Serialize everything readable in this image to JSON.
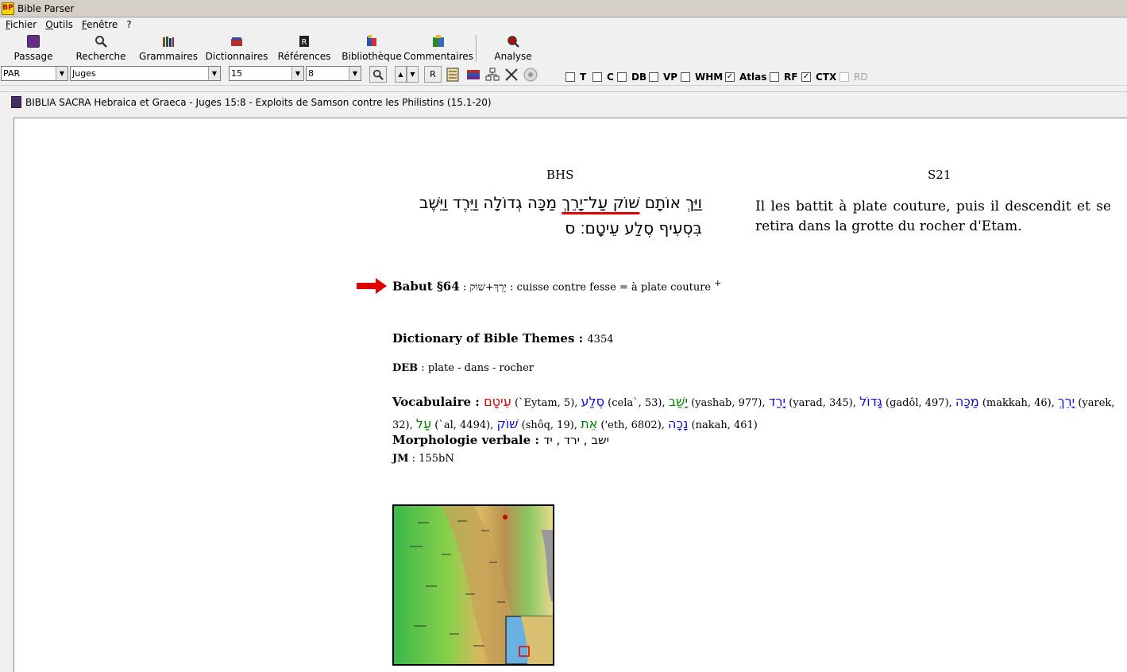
{
  "window": {
    "title": "Bible Parser",
    "app_icon": "BP"
  },
  "menu": [
    "Fichier",
    "Outils",
    "Fenêtre",
    "?"
  ],
  "toolbar": {
    "buttons": [
      {
        "label": "Passage",
        "icon": "passage-icon",
        "color": "#6a2a8a"
      },
      {
        "label": "Recherche",
        "icon": "search-icon",
        "color": "#333333"
      },
      {
        "label": "Grammaires",
        "icon": "books-icon",
        "color": "#7a4a2a"
      },
      {
        "label": "Dictionnaires",
        "icon": "dictionary-icon",
        "color": "#b03030"
      },
      {
        "label": "Références",
        "icon": "references-icon",
        "color": "#222222"
      },
      {
        "label": "Bibliothèque",
        "icon": "library-icon",
        "color": "#3050b0"
      },
      {
        "label": "Commentaires",
        "icon": "comments-icon",
        "color": "#2a8a2a"
      },
      {
        "label": "Analyse",
        "icon": "analyse-icon",
        "color": "#b01010"
      }
    ]
  },
  "controls": {
    "version": "PAR",
    "book": "Juges",
    "chapter": "15",
    "verse": "8",
    "r_button": "R",
    "checkboxes": [
      {
        "label": "T",
        "checked": false,
        "enabled": true
      },
      {
        "label": "C",
        "checked": false,
        "enabled": true
      },
      {
        "label": "DB",
        "checked": false,
        "enabled": true
      },
      {
        "label": "VP",
        "checked": false,
        "enabled": true
      },
      {
        "label": "WHM",
        "checked": false,
        "enabled": true
      },
      {
        "label": "Atlas",
        "checked": true,
        "enabled": true
      },
      {
        "label": "RF",
        "checked": false,
        "enabled": true
      },
      {
        "label": "CTX",
        "checked": true,
        "enabled": true
      },
      {
        "label": "RD",
        "checked": false,
        "enabled": false
      }
    ]
  },
  "document": {
    "title": "BIBLIA SACRA Hebraica et Graeca - Juges 15:8 - Exploits de Samson contre les Philistins (15.1-20)"
  },
  "columns": {
    "left_header": "BHS",
    "right_header": "S21",
    "hebrew_pre": "וַיַּךְ אוֹתָם ",
    "hebrew_underlined": "שׁוֹק עַל־יָרֵךְ",
    "hebrew_post": " מַכָּה גְדוֹלָה וַיֵּרֶד וַיֵּשֶׁב בִּסְעִיף סֶלַע עֵיטָם׃ ס",
    "translation": "Il les battit à plate couture, puis il descendit et se retira dans la grotte du rocher d'Etam."
  },
  "babut": {
    "label": "Babut §64",
    "sep": " : ",
    "hebrew": "יָרֵךְ+שׁוֹק",
    "text": " : cuisse contre fesse = à plate couture ",
    "sup": "+"
  },
  "dbt": {
    "label": "Dictionary of Bible Themes",
    "sep": " : ",
    "value": "4354"
  },
  "deb": {
    "label": "DEB",
    "value": " : plate - dans - rocher"
  },
  "vocabulary": {
    "label": "Vocabulaire",
    "sep": " : ",
    "items": [
      {
        "hebrew": "עֵיטָם",
        "info": "(`Eytam, 5)",
        "color": "#e00000"
      },
      {
        "hebrew": "סֶלַע",
        "info": "(cela`, 53)",
        "color": "#1010d0"
      },
      {
        "hebrew": "יָשַׁב",
        "info": "(yashab, 977)",
        "color": "#008000"
      },
      {
        "hebrew": "יָרַד",
        "info": "(yarad, 345)",
        "color": "#1010d0"
      },
      {
        "hebrew": "גָּדוֹל",
        "info": "(gadôl, 497)",
        "color": "#1010d0"
      },
      {
        "hebrew": "מַכָּה",
        "info": "(makkah, 46)",
        "color": "#1010d0"
      },
      {
        "hebrew": "יָרֵךְ",
        "info": "(yarek, 32)",
        "color": "#1010d0"
      },
      {
        "hebrew": "עַל",
        "info": "(`al, 4494)",
        "color": "#008000"
      },
      {
        "hebrew": "שׁוֹק",
        "info": "(shôq, 19)",
        "color": "#1010d0"
      },
      {
        "hebrew": "אֵת",
        "info": "('eth, 6802)",
        "color": "#008000"
      },
      {
        "hebrew": "נָכָה",
        "info": "(nakah, 461)",
        "color": "#1010d0"
      }
    ]
  },
  "morphology": {
    "label": "Morphologie verbale",
    "sep": " : ",
    "value": "ישב , ירד , יד"
  },
  "jm": {
    "label": "JM",
    "value": " : 155bN"
  },
  "colors": {
    "accent_red": "#e00000",
    "highlight_blue": "#1010d0",
    "highlight_green": "#008000"
  }
}
